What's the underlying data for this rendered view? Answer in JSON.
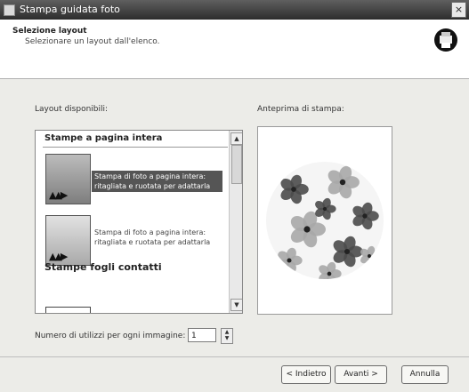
{
  "window": {
    "title": "Stampa guidata foto",
    "close_glyph": "×"
  },
  "header": {
    "title": "Selezione layout",
    "subtitle": "Selezionare un layout dall'elenco.",
    "icon": "printer-wizard-icon"
  },
  "layouts": {
    "label": "Layout disponibili:",
    "categories": [
      {
        "label": "Stampe a pagina intera"
      },
      {
        "label": "Stampe fogli contatti"
      }
    ],
    "items": [
      {
        "label": "Stampa di foto a pagina intera: ritagliata e ruotata per adattarla",
        "selected": true
      },
      {
        "label": "Stampa di foto a pagina intera: ritagliata e ruotata per adattarla",
        "selected": false
      }
    ],
    "thumb_glyph": "▲▲▶"
  },
  "preview": {
    "label": "Anteprima di stampa:"
  },
  "copies": {
    "label": "Numero di utilizzi per ogni immagine:",
    "value": "1"
  },
  "scroll": {
    "up": "▲",
    "down": "▼"
  },
  "buttons": {
    "back": "< Indietro",
    "next": "Avanti >",
    "cancel": "Annulla"
  },
  "colors": {
    "title_bar": "#3a3a3a",
    "selection": "#555555",
    "flower_dark": "#4b4b4b",
    "flower_light": "#a8a8a8"
  }
}
